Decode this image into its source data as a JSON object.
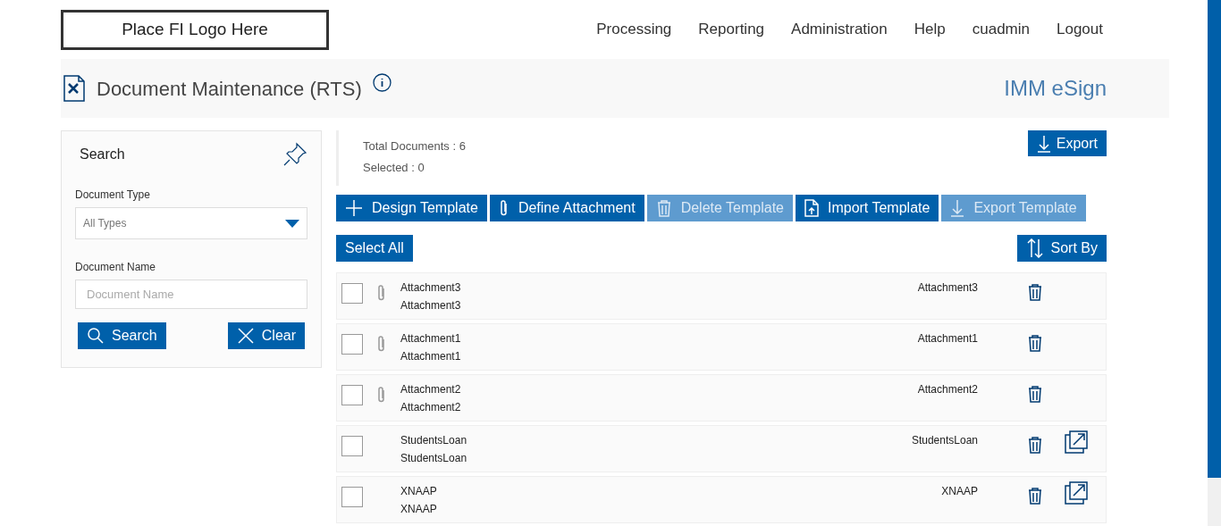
{
  "logo": "Place FI Logo Here",
  "nav": [
    "Processing",
    "Reporting",
    "Administration",
    "Help",
    "cuadmin",
    "Logout"
  ],
  "page_title": "Document Maintenance (RTS)",
  "product": "IMM eSign",
  "search_panel": {
    "title": "Search",
    "document_type": {
      "label": "Document Type",
      "value": "All Types"
    },
    "document_name": {
      "label": "Document Name",
      "placeholder": "Document Name"
    },
    "buttons": [
      {
        "kind": "search",
        "label": "Search"
      },
      {
        "kind": "clear",
        "label": "Clear"
      }
    ]
  },
  "summary": {
    "total": "Total Documents : 6",
    "selected": "Selected : 0"
  },
  "export_button": "Export",
  "toolbar": [
    {
      "kind": "plus",
      "label": "Design Template",
      "disabled": false
    },
    {
      "kind": "clip",
      "label": "Define Attachment",
      "disabled": false
    },
    {
      "kind": "trash",
      "label": "Delete Template",
      "disabled": true
    },
    {
      "kind": "import",
      "label": "Import Template",
      "disabled": false
    },
    {
      "kind": "download",
      "label": "Export Template",
      "disabled": true
    }
  ],
  "select_all": "Select All",
  "sort_by": "Sort By",
  "documents": [
    {
      "kind": "attachment",
      "name": "Attachment3",
      "description": "Attachment3",
      "column_3": "Attachment3",
      "checked": false,
      "exportable": false
    },
    {
      "kind": "attachment",
      "name": "Attachment1",
      "description": "Attachment1",
      "column_3": "Attachment1",
      "checked": false,
      "exportable": false
    },
    {
      "kind": "attachment",
      "name": "Attachment2",
      "description": "Attachment2",
      "column_3": "Attachment2",
      "checked": false,
      "exportable": false
    },
    {
      "kind": "template",
      "name": "StudentsLoan",
      "description": "StudentsLoan",
      "column_3": "StudentsLoan",
      "checked": false,
      "exportable": true
    },
    {
      "kind": "template",
      "name": "XNAAP",
      "description": "XNAAP",
      "column_3": "XNAAP",
      "checked": false,
      "exportable": true
    }
  ]
}
